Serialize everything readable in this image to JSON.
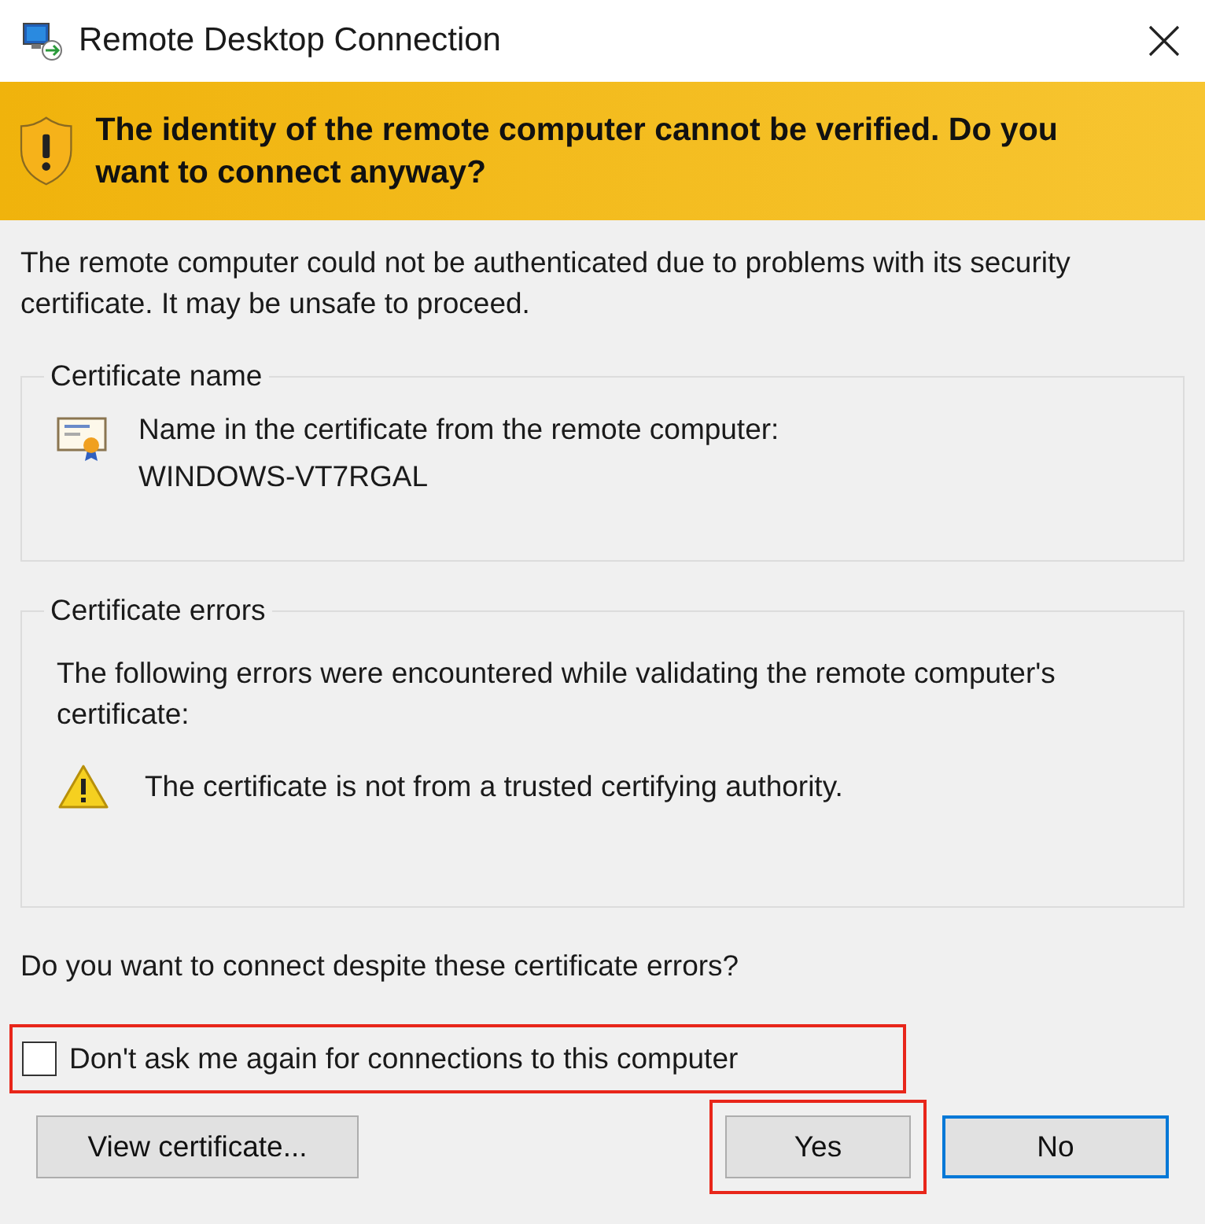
{
  "window": {
    "title": "Remote Desktop Connection"
  },
  "banner": {
    "text": "The identity of the remote computer cannot be verified. Do you want to connect anyway?"
  },
  "message": "The remote computer could not be authenticated due to problems with its security certificate. It may be unsafe to proceed.",
  "certificate_name": {
    "legend": "Certificate name",
    "label": "Name in the certificate from the remote computer:",
    "value": "WINDOWS-VT7RGAL"
  },
  "certificate_errors": {
    "legend": "Certificate errors",
    "intro": "The following errors were encountered while validating the remote computer's certificate:",
    "errors": [
      "The certificate is not from a trusted certifying authority."
    ]
  },
  "question": "Do you want to connect despite these certificate errors?",
  "dont_ask": {
    "label": "Don't ask me again for connections to this computer",
    "checked": false,
    "highlighted": true
  },
  "buttons": [
    {
      "label": "View certificate...",
      "default": false,
      "highlighted": false
    },
    {
      "label": "Yes",
      "default": false,
      "highlighted": true
    },
    {
      "label": "No",
      "default": true,
      "highlighted": false
    }
  ]
}
